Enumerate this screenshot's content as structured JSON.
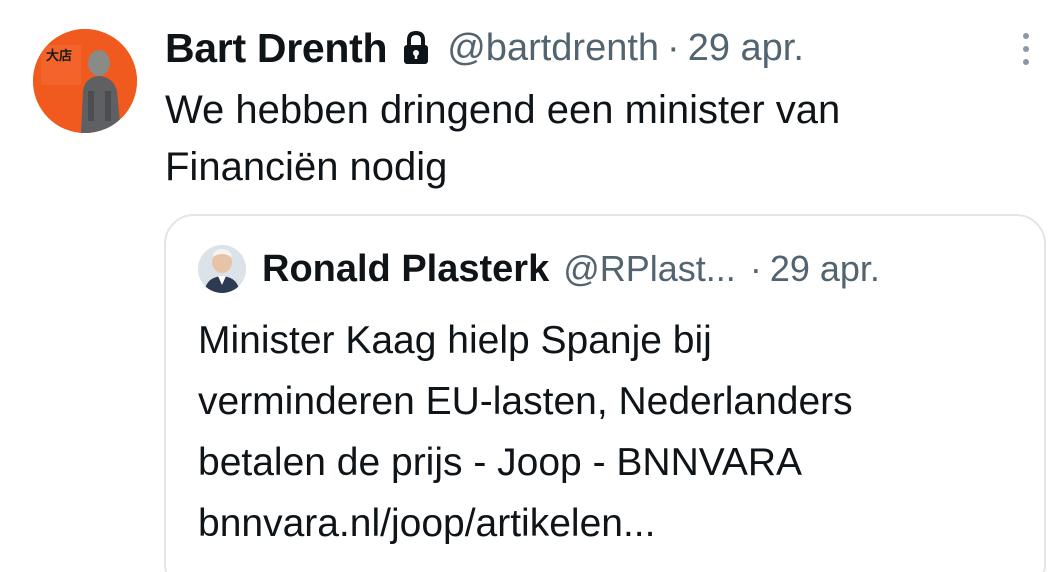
{
  "tweet": {
    "author": {
      "display_name": "Bart Drenth",
      "handle": "@bartdrenth",
      "avatar_logo_text": "大店",
      "avatar_bg": "#f15a1e"
    },
    "time_separator": "·",
    "timestamp": "29 apr.",
    "text_lines": [
      "We hebben dringend een minister van",
      "Financiën nodig"
    ],
    "icons": {
      "protected": "lock-icon",
      "more": "more-vertical-icon"
    }
  },
  "quote": {
    "author": {
      "display_name": "Ronald Plasterk",
      "handle": "@RPlast..."
    },
    "time_separator": "·",
    "timestamp": "29 apr.",
    "text_lines": [
      "Minister Kaag hielp Spanje bij",
      "verminderen EU-lasten, Nederlanders",
      "betalen de prijs - Joop - BNNVARA",
      "bnnvara.nl/joop/artikelen..."
    ]
  },
  "colors": {
    "text_primary": "#0f1419",
    "text_secondary": "#536471",
    "border": "#e1e6ea"
  }
}
